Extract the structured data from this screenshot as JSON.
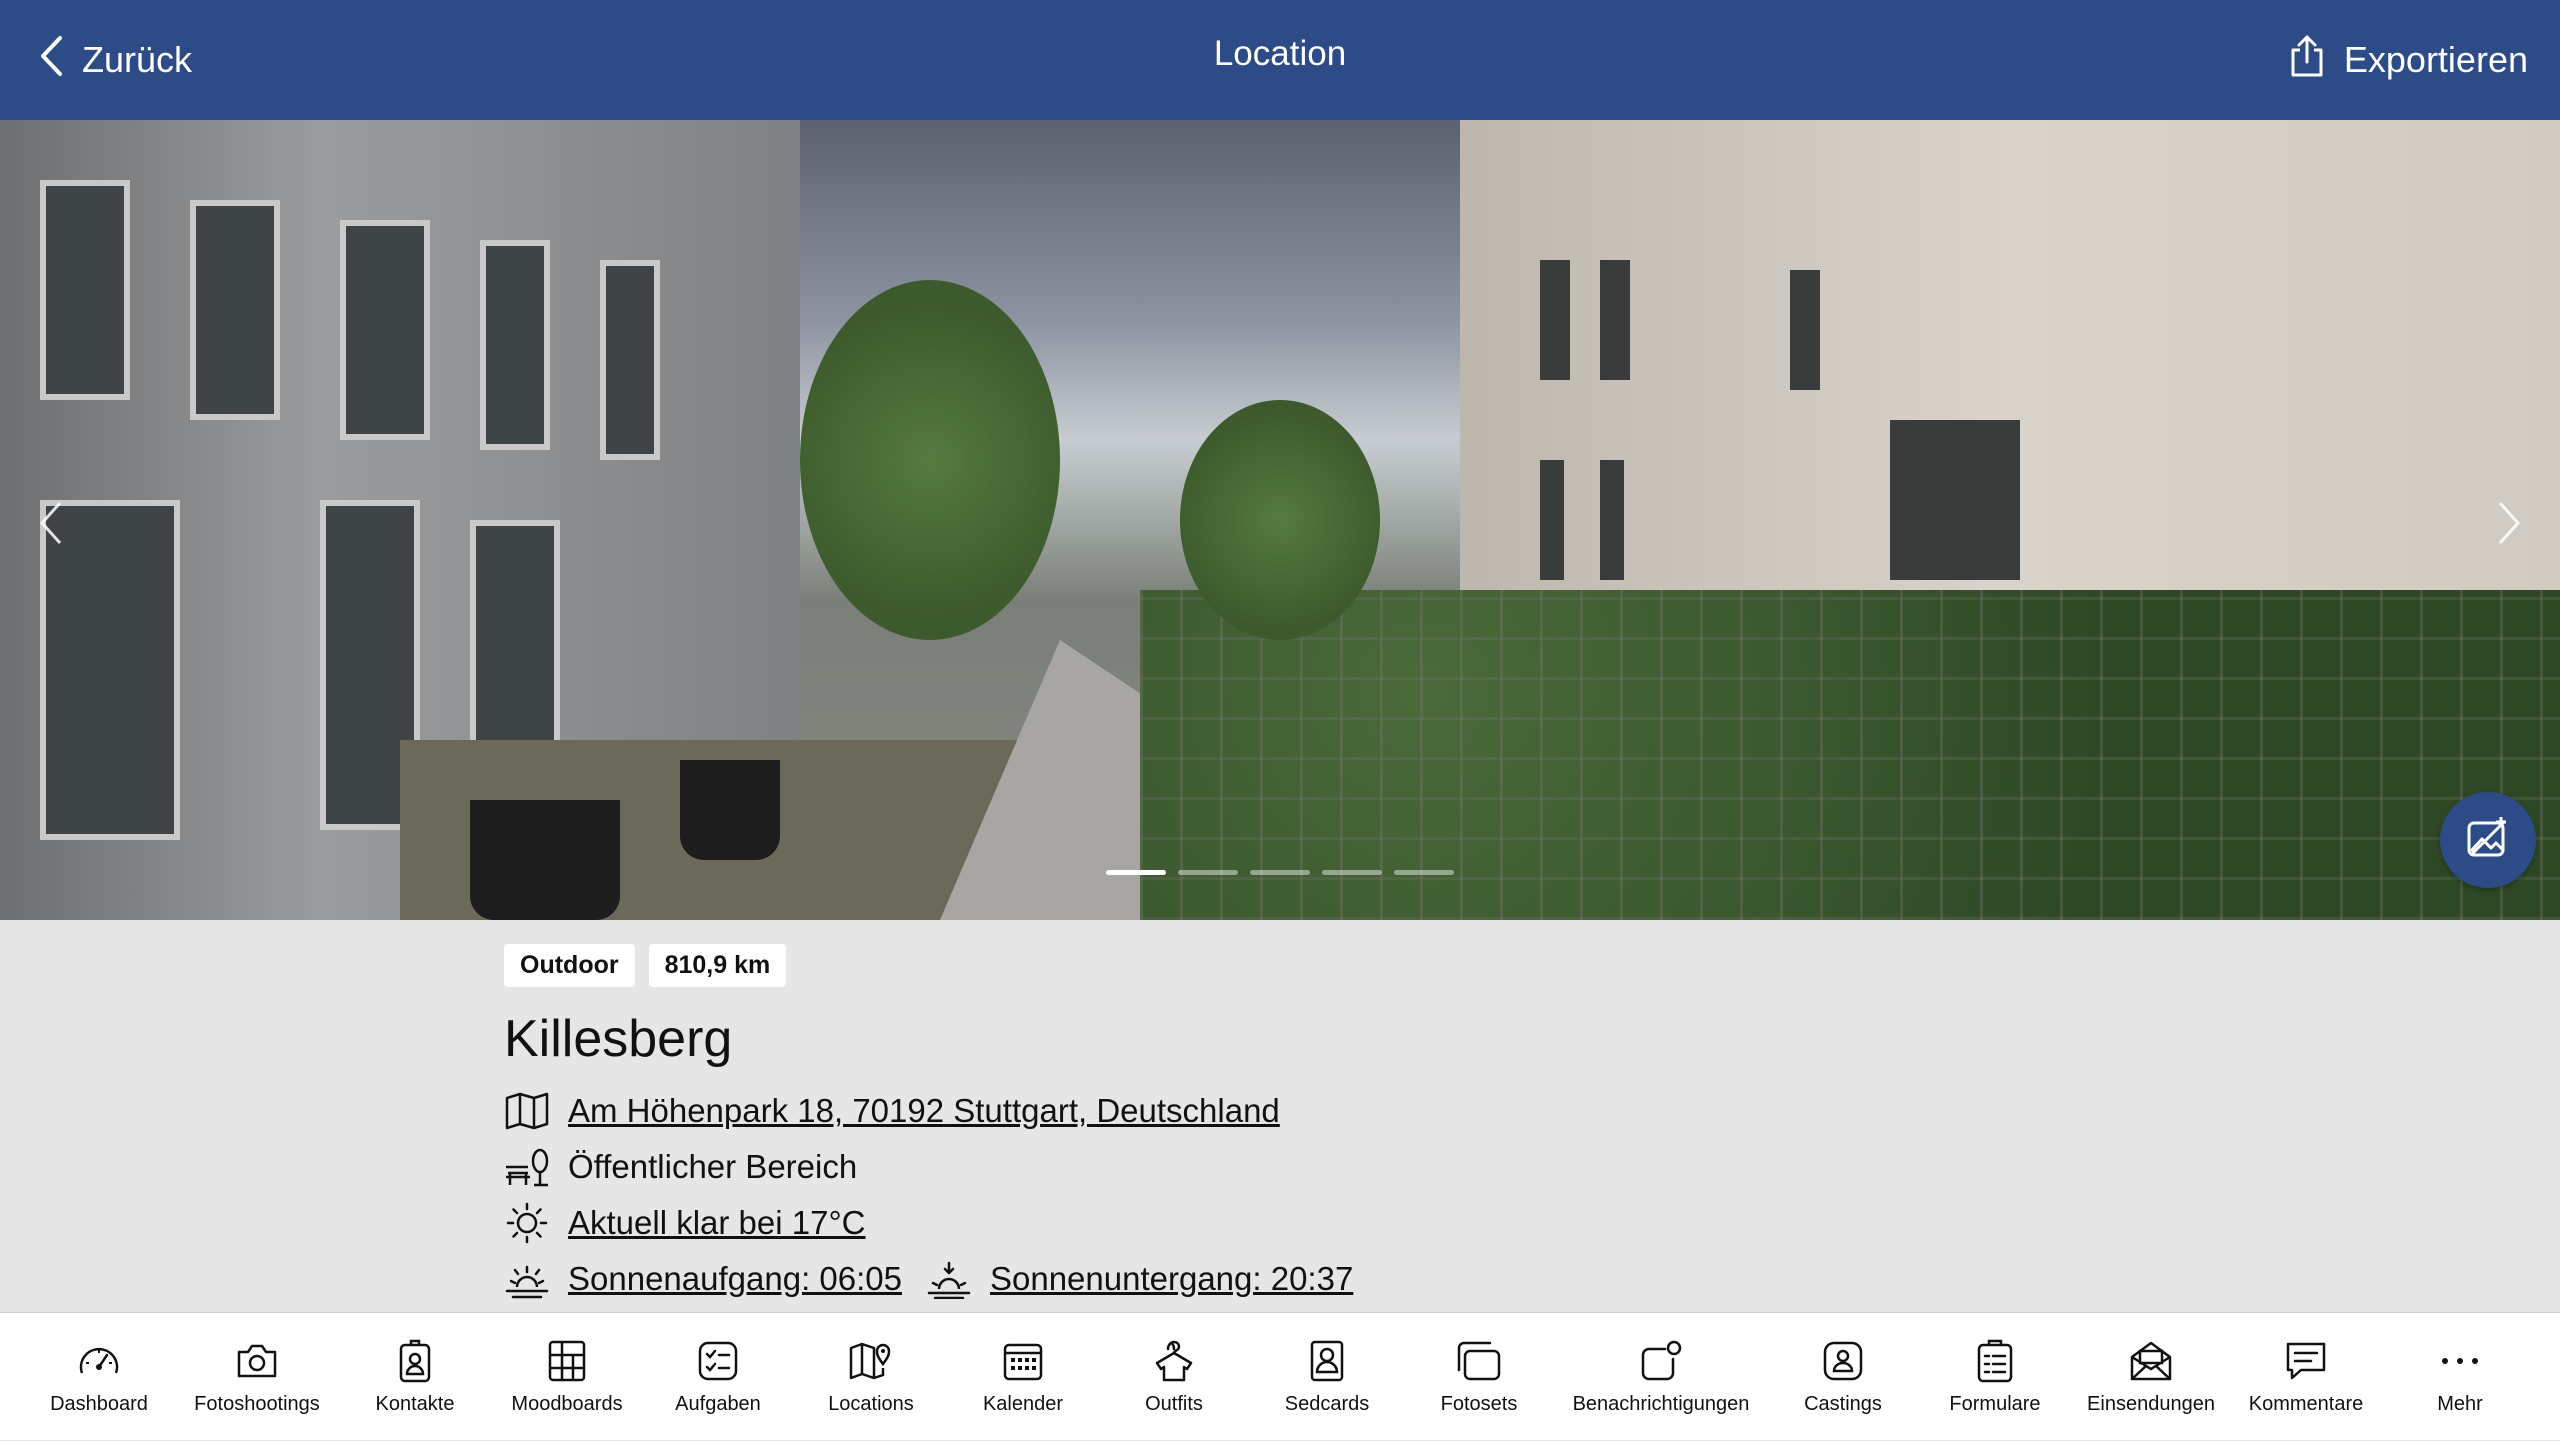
{
  "header": {
    "back_label": "Zurück",
    "title": "Location",
    "export_label": "Exportieren",
    "bar_color": "#2d4b86"
  },
  "gallery": {
    "image_count": 5,
    "active_index": 0,
    "prev_icon": "chevron-left-icon",
    "next_icon": "chevron-right-icon",
    "fab_icon": "photo-edit-icon"
  },
  "location": {
    "tags": [
      "Outdoor",
      "810,9 km"
    ],
    "name": "Killesberg",
    "address": "Am Höhenpark 18, 70192 Stuttgart, Deutschland",
    "area": "Öffentlicher Bereich",
    "weather": "Aktuell klar bei 17°C",
    "sunrise": "Sonnenaufgang: 06:05",
    "sunset": "Sonnenuntergang: 20:37"
  },
  "tabbar": {
    "items": [
      {
        "label": "Dashboard",
        "icon": "dashboard-icon"
      },
      {
        "label": "Fotoshootings",
        "icon": "camera-icon"
      },
      {
        "label": "Kontakte",
        "icon": "contact-icon"
      },
      {
        "label": "Moodboards",
        "icon": "moodboard-icon"
      },
      {
        "label": "Aufgaben",
        "icon": "tasks-icon"
      },
      {
        "label": "Locations",
        "icon": "map-pin-icon"
      },
      {
        "label": "Kalender",
        "icon": "calendar-icon"
      },
      {
        "label": "Outfits",
        "icon": "outfit-icon"
      },
      {
        "label": "Sedcards",
        "icon": "sedcard-icon"
      },
      {
        "label": "Fotosets",
        "icon": "fotosets-icon"
      },
      {
        "label": "Benachrichtigungen",
        "icon": "notification-icon"
      },
      {
        "label": "Castings",
        "icon": "casting-icon"
      },
      {
        "label": "Formulare",
        "icon": "form-icon"
      },
      {
        "label": "Einsendungen",
        "icon": "submissions-icon"
      },
      {
        "label": "Kommentare",
        "icon": "comment-icon"
      },
      {
        "label": "Mehr",
        "icon": "more-icon"
      }
    ]
  }
}
